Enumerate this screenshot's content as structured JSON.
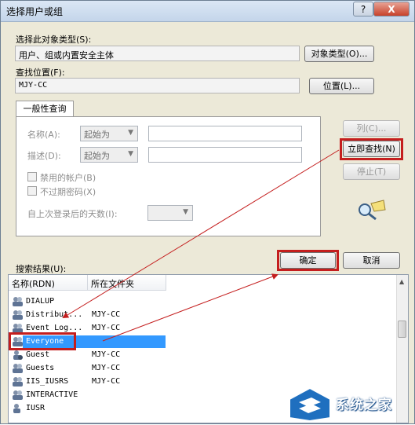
{
  "window": {
    "title": "选择用户或组",
    "help_label": "?",
    "close_label": "X"
  },
  "object_type": {
    "label": "选择此对象类型(S):",
    "value": "用户、组或内置安全主体",
    "button": "对象类型(O)..."
  },
  "location": {
    "label": "查找位置(F):",
    "value": "MJY-CC",
    "button": "位置(L)..."
  },
  "general_query": {
    "tab_label": "一般性查询",
    "name_label": "名称(A):",
    "name_mode": "起始为",
    "desc_label": "描述(D):",
    "desc_mode": "起始为",
    "disabled_accounts_label": "禁用的帐户(B)",
    "non_expiring_label": "不过期密码(X)",
    "days_since_login_label": "自上次登录后的天数(I):"
  },
  "side_buttons": {
    "columns": "列(C)...",
    "find_now": "立即查找(N)",
    "stop": "停止(T)"
  },
  "dialog_buttons": {
    "ok": "确定",
    "cancel": "取消"
  },
  "results": {
    "label": "搜索结果(U):",
    "columns": [
      "名称(RDN)",
      "所在文件夹"
    ],
    "rows": [
      {
        "name": "DIALUP",
        "folder": "",
        "icon": "group-icon"
      },
      {
        "name": "Distribut...",
        "folder": "MJY-CC",
        "icon": "group-icon"
      },
      {
        "name": "Event Log...",
        "folder": "MJY-CC",
        "icon": "group-icon"
      },
      {
        "name": "Everyone",
        "folder": "",
        "icon": "group-icon",
        "selected": true
      },
      {
        "name": "Guest",
        "folder": "MJY-CC",
        "icon": "user-icon"
      },
      {
        "name": "Guests",
        "folder": "MJY-CC",
        "icon": "group-icon"
      },
      {
        "name": "IIS_IUSRS",
        "folder": "MJY-CC",
        "icon": "group-icon"
      },
      {
        "name": "INTERACTIVE",
        "folder": "",
        "icon": "group-icon"
      },
      {
        "name": "IUSR",
        "folder": "",
        "icon": "user-icon"
      }
    ]
  },
  "watermark": {
    "text": "系统之家"
  },
  "colors": {
    "highlight": "#3399ff",
    "annotation_red": "#c41e1e",
    "dialog_bg": "#ece9d8"
  }
}
